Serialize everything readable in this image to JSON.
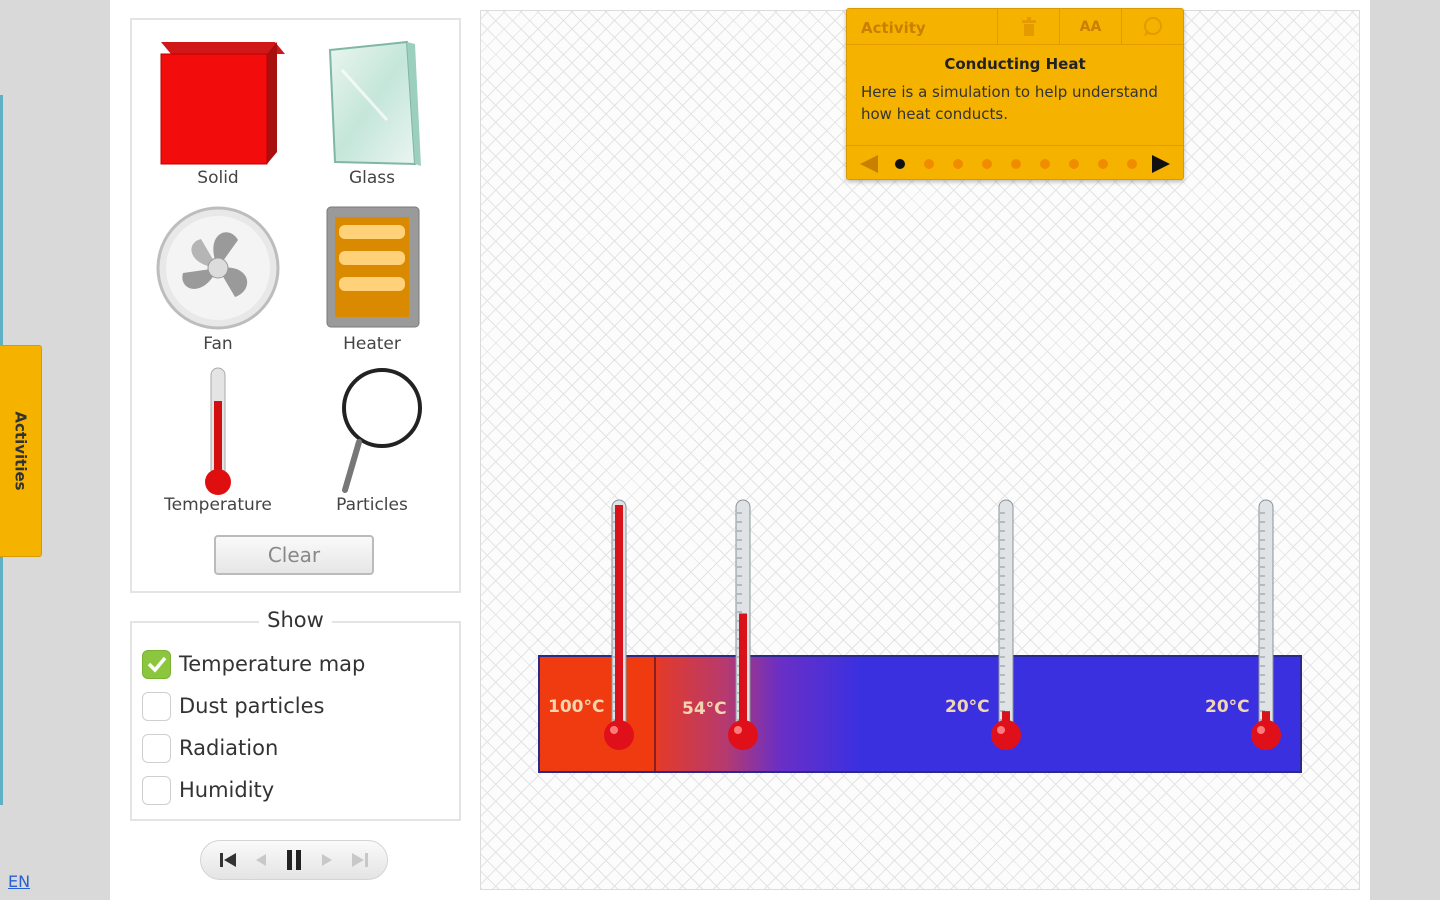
{
  "sidebar": {
    "activities_label": "Activities",
    "language": "EN"
  },
  "tools": [
    {
      "name": "solid",
      "label": "Solid"
    },
    {
      "name": "glass",
      "label": "Glass"
    },
    {
      "name": "fan",
      "label": "Fan"
    },
    {
      "name": "heater",
      "label": "Heater"
    },
    {
      "name": "temperature",
      "label": "Temperature"
    },
    {
      "name": "particles",
      "label": "Particles"
    }
  ],
  "clear_label": "Clear",
  "show": {
    "title": "Show",
    "options": [
      {
        "label": "Temperature map",
        "checked": true
      },
      {
        "label": "Dust particles",
        "checked": false
      },
      {
        "label": "Radiation",
        "checked": false
      },
      {
        "label": "Humidity",
        "checked": false
      }
    ]
  },
  "activity": {
    "tab_label": "Activity",
    "font_size_icon": "AA",
    "title": "Conducting Heat",
    "text": "Here is a simulation to help understand how heat conducts.",
    "total_steps": 9,
    "current_step": 1
  },
  "thermometers": [
    {
      "label": "100°C",
      "level": 1.0
    },
    {
      "label": "54°C",
      "level": 0.5
    },
    {
      "label": "20°C",
      "level": 0.05
    },
    {
      "label": "20°C",
      "level": 0.05
    }
  ],
  "colors": {
    "accent": "#f5b300",
    "hot": "#f03a10",
    "cold": "#3b30e0",
    "check": "#8cc63f"
  },
  "playback": {
    "state": "playing"
  }
}
